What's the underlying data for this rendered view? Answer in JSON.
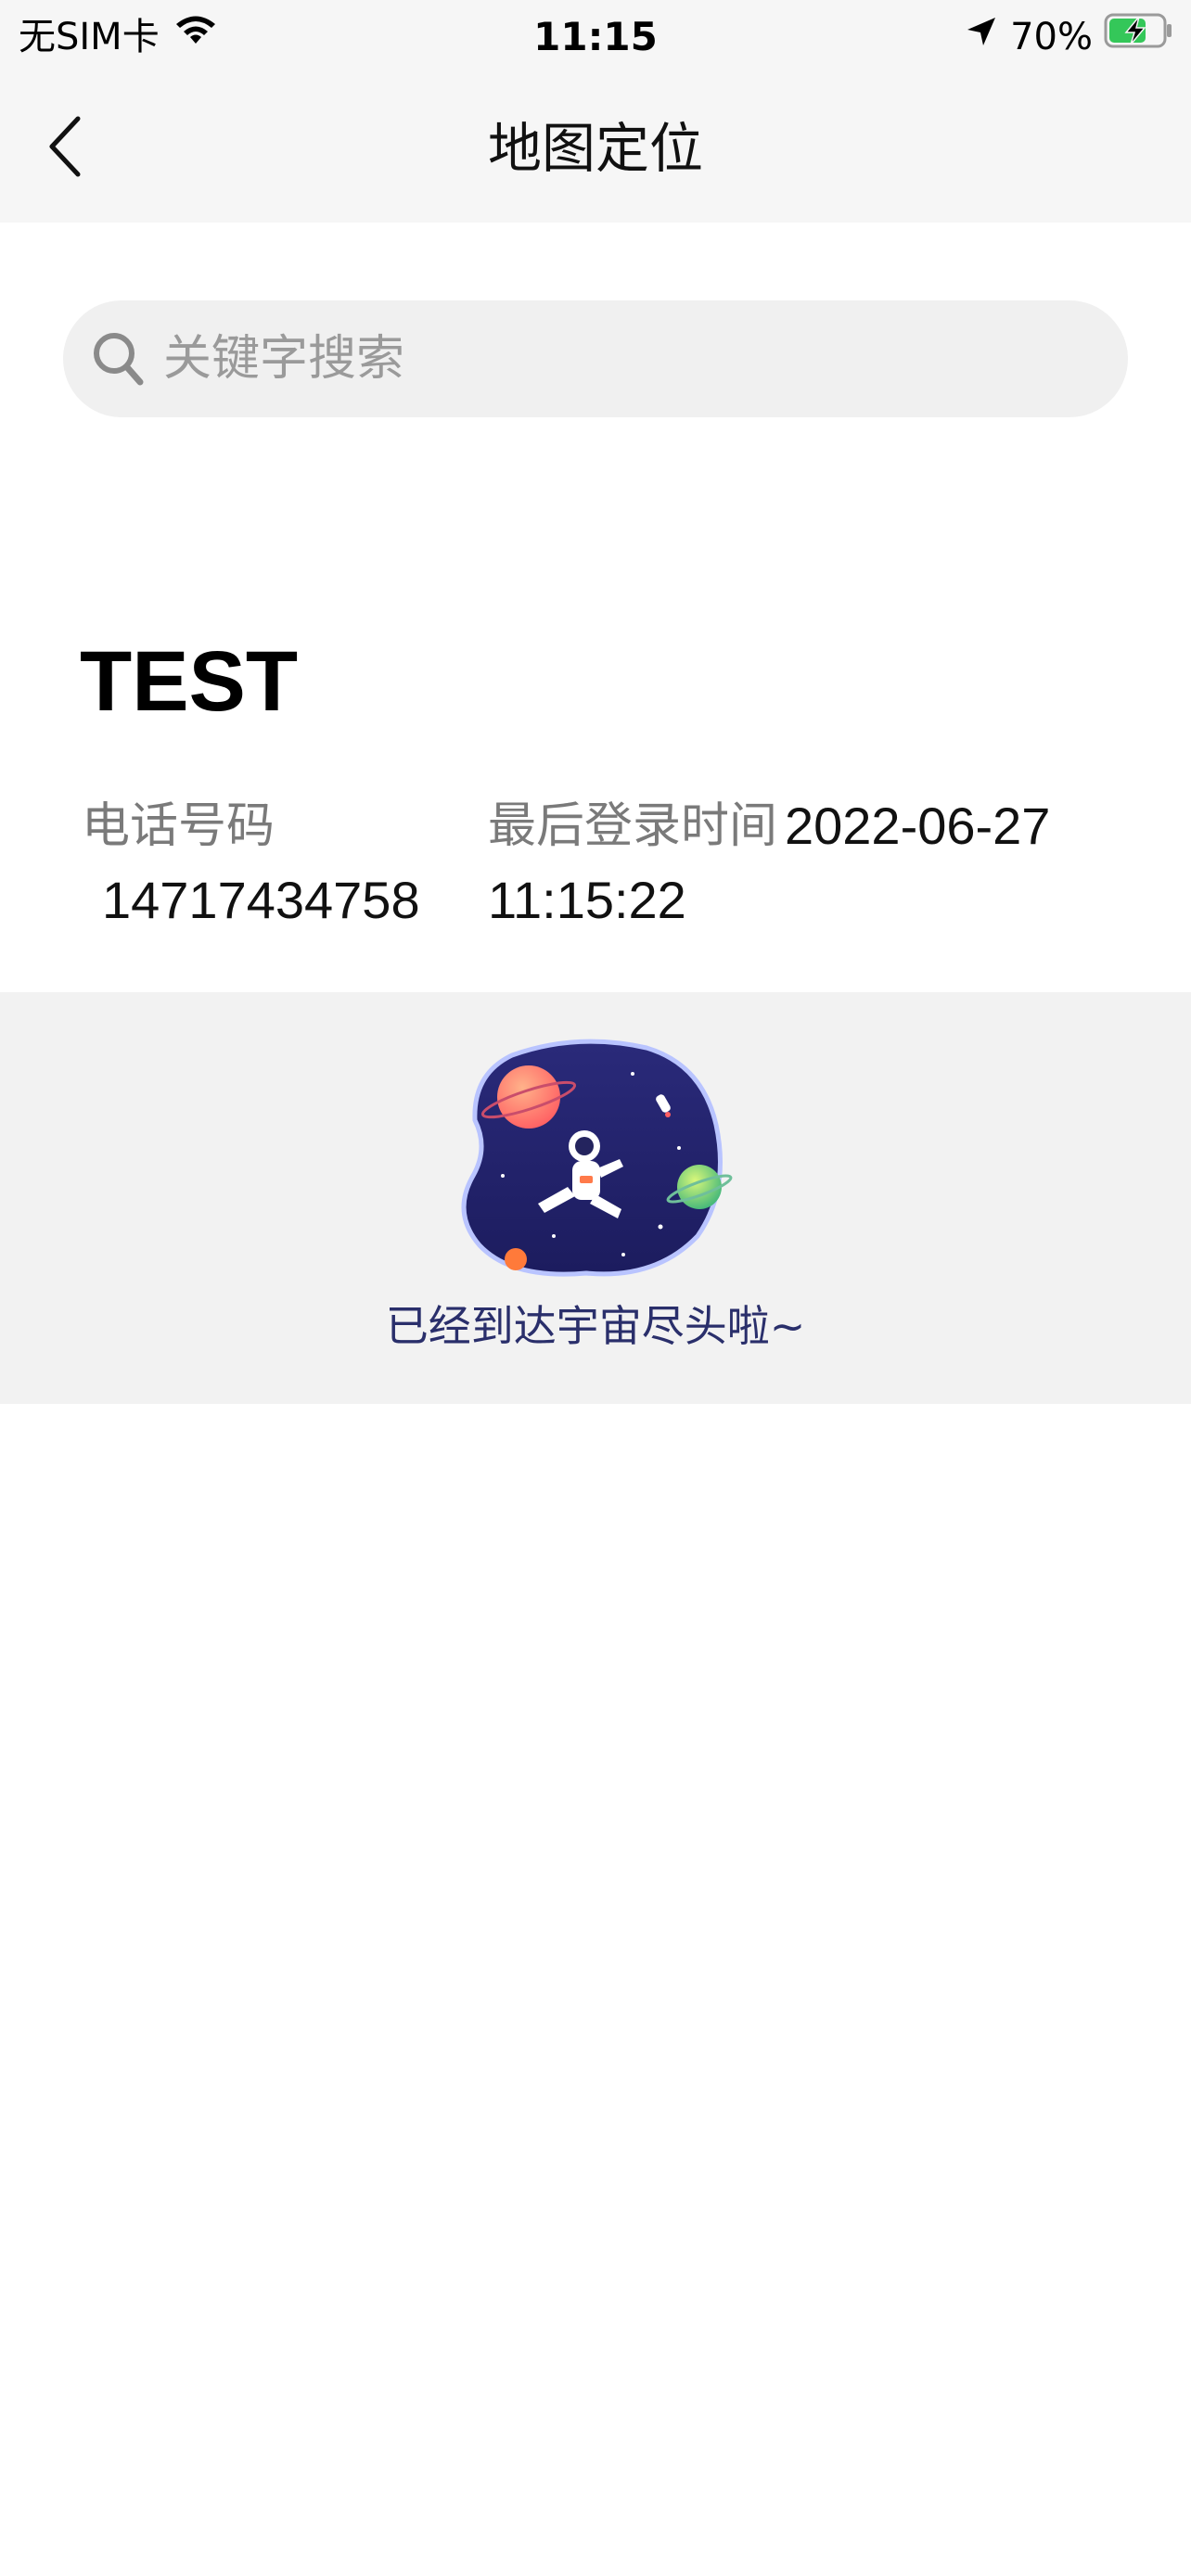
{
  "status_bar": {
    "carrier": "无SIM卡",
    "time": "11:15",
    "battery_percent": "70%",
    "battery_level": 0.7,
    "icons": [
      "wifi-icon",
      "location-arrow-icon",
      "battery-charging-icon"
    ]
  },
  "nav": {
    "title": "地图定位",
    "back_icon": "chevron-left-icon"
  },
  "search": {
    "placeholder": "关键字搜索",
    "value": "",
    "icon": "search-icon"
  },
  "user": {
    "name": "TEST",
    "phone_label": "电话号码",
    "phone_value": "14717434758",
    "last_login_label": "最后登录时间",
    "last_login_date": "2022-06-27",
    "last_login_time": "11:15:22"
  },
  "footer": {
    "end_text": "已经到达宇宙尽头啦~",
    "illustration": "astronaut-space-illustration"
  },
  "colors": {
    "status_bar_bg": "#f6f6f6",
    "search_bg": "#f0f0f0",
    "end_section_bg": "#f2f2f2",
    "end_text": "#2a2f6b",
    "battery_green": "#34c759"
  }
}
